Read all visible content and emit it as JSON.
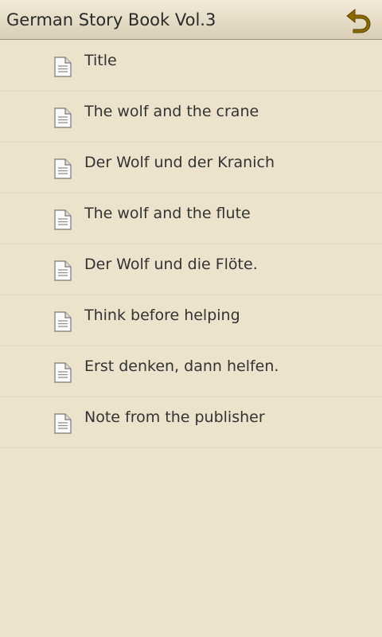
{
  "header": {
    "title": "German Story Book Vol.3",
    "back_icon": "back-arrow-icon"
  },
  "items": [
    {
      "label": "Title",
      "icon": "document-icon"
    },
    {
      "label": "The wolf and the crane",
      "icon": "document-icon"
    },
    {
      "label": "Der Wolf und der Kranich",
      "icon": "document-icon"
    },
    {
      "label": "The wolf and the flute",
      "icon": "document-icon"
    },
    {
      "label": "Der Wolf und die Flöte.",
      "icon": "document-icon"
    },
    {
      "label": "Think before helping",
      "icon": "document-icon"
    },
    {
      "label": "Erst denken, dann helfen.",
      "icon": "document-icon"
    },
    {
      "label": "Note from the publisher",
      "icon": "document-icon"
    }
  ],
  "colors": {
    "background": "#ede2cb",
    "header_top": "#f3ebd9",
    "header_bottom": "#d9ceb6",
    "back_icon": "#8a6a00",
    "text": "#333333"
  }
}
